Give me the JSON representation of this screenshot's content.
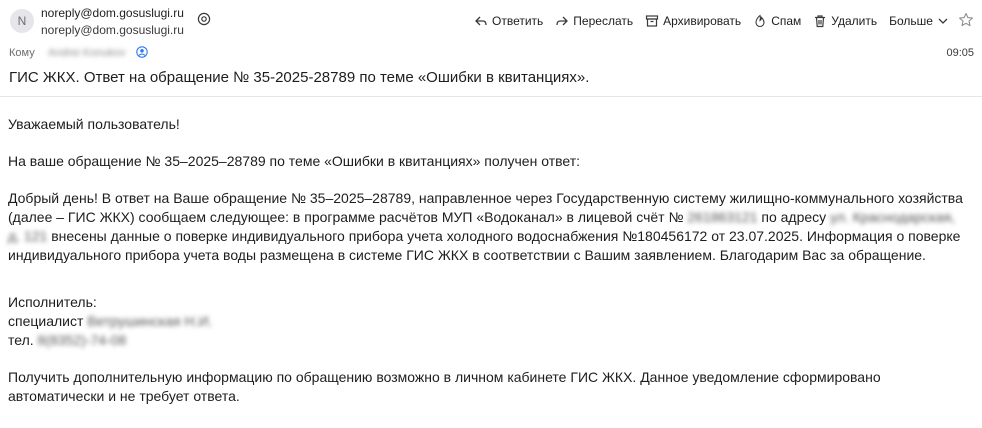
{
  "header": {
    "avatar_letter": "N",
    "from_line1": "noreply@dom.gosuslugi.ru",
    "from_line2": "noreply@dom.gosuslugi.ru",
    "to_label": "Кому",
    "to_name_blurred": "Andrei Konukov",
    "time": "09:05",
    "subject": "ГИС ЖКХ. Ответ на обращение № 35-2025-28789 по теме «Ошибки в квитанциях»."
  },
  "toolbar": {
    "reply": "Ответить",
    "forward": "Переслать",
    "archive": "Архивировать",
    "spam": "Спам",
    "delete": "Удалить",
    "more": "Больше"
  },
  "icons": {
    "reply": "reply-icon",
    "forward": "forward-icon",
    "archive": "archive-icon",
    "spam": "spam-icon",
    "delete": "trash-icon",
    "more": "chevron-down-icon",
    "star": "star-icon",
    "at": "at-icon"
  },
  "body": {
    "greeting": "Уважаемый пользователь!",
    "intro": "На ваше обращение № 35–2025–28789 по теме «Ошибки в квитанциях» получен ответ:",
    "main_part1": "Добрый день! В ответ на Ваше обращение № 35–2025–28789, направленное через Государственную систему жилищно-коммунального хозяйства (далее – ГИС ЖКХ) сообщаем следующее: в программе расчётов МУП «Водоканал» в лицевой счёт № ",
    "main_blur_account": "261863121",
    "main_part2": " по адресу ",
    "main_blur_address": "ул. Краснодарская, д. 121",
    "main_part3": " внесены данные о поверке индивидуального прибора учета холодного водоснабжения №180456172 от 23.07.2025. Информация о поверке индивидуального прибора учета воды размещена в системе ГИС ЖКХ в соответствии с Вашим заявлением. Благодарим Вас за обращение.",
    "executor_label": "Исполнитель:",
    "specialist_label": "специалист",
    "specialist_blur": "Ветрушинская Н.И.",
    "phone_label": "тел.",
    "phone_blur": "8(8352)-74-08",
    "footer": "Получить дополнительную информацию по обращению возможно в личном кабинете ГИС ЖКХ. Данное уведомление сформировано автоматически и не требует ответа."
  }
}
